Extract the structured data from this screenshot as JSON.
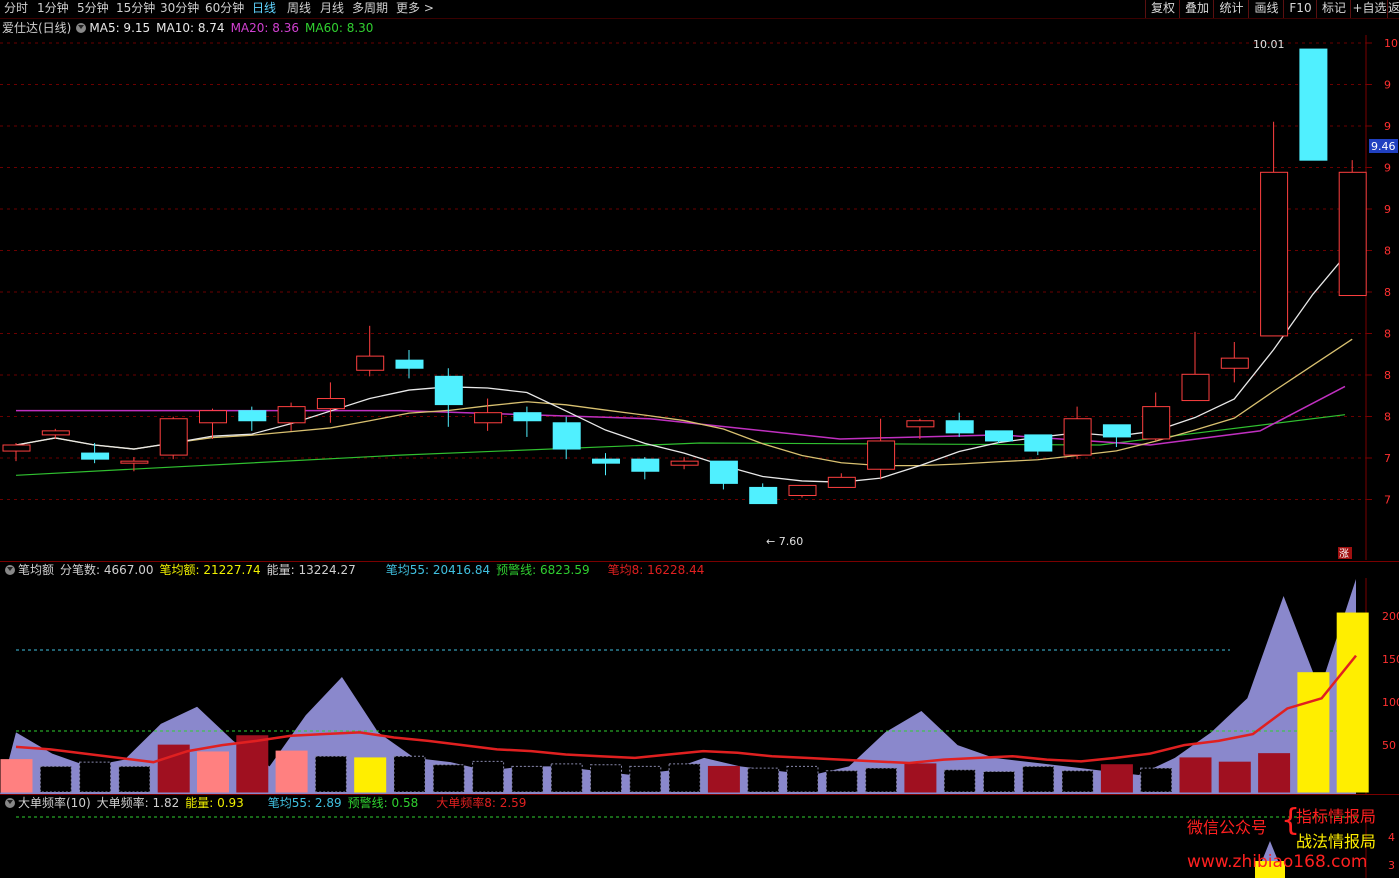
{
  "topbar": {
    "timeframes": [
      "分时",
      "1分钟",
      "5分钟",
      "15分钟",
      "30分钟",
      "60分钟",
      "日线",
      "周线",
      "月线",
      "多周期",
      "更多 >"
    ],
    "active_index": 6,
    "tools": [
      "复权",
      "叠加",
      "统计",
      "画线",
      "F10",
      "标记",
      "+自选",
      "返"
    ]
  },
  "main_legend": {
    "title": "爱仕达(日线)",
    "items": [
      {
        "label": "MA5: 9.15",
        "color": "#e8e8e8"
      },
      {
        "label": "MA10: 8.74",
        "color": "#e8e8e8"
      },
      {
        "label": "MA20: 8.36",
        "color": "#d040d0"
      },
      {
        "label": "MA60: 8.30",
        "color": "#30d030"
      }
    ]
  },
  "price_axis": {
    "labels": [
      "10",
      "9",
      "9",
      "9",
      "9",
      "8",
      "8",
      "8",
      "8",
      "8",
      "7",
      "7"
    ],
    "current_price": "9.46",
    "high_label": "10.01",
    "low_label": "7.60",
    "zhang": "涨"
  },
  "panel1_legend": {
    "items": [
      {
        "label": "笔均额",
        "color": "#d0d0d0"
      },
      {
        "label": "分笔数: 4667.00",
        "color": "#d0d0d0"
      },
      {
        "label": "笔均额: 21227.74",
        "color": "#f0f000"
      },
      {
        "label": "能量: 13224.27",
        "color": "#d0d0d0"
      },
      {
        "label": "笔均55: 20416.84",
        "color": "#40c0e0"
      },
      {
        "label": "预警线: 6823.59",
        "color": "#30d030"
      },
      {
        "label": "笔均8: 16228.44",
        "color": "#e02020"
      }
    ],
    "axis": [
      "200",
      "150",
      "100",
      "50"
    ]
  },
  "panel2_legend": {
    "items": [
      {
        "label": "大单频率(10)",
        "color": "#d0d0d0"
      },
      {
        "label": "大单频率: 1.82",
        "color": "#d0d0d0"
      },
      {
        "label": "能量: 0.93",
        "color": "#f0f000"
      },
      {
        "label": "笔均55: 2.89",
        "color": "#40c0e0"
      },
      {
        "label": "预警线: 0.58",
        "color": "#30d030"
      },
      {
        "label": "大单频率8: 2.59",
        "color": "#e02020"
      }
    ],
    "axis": [
      "4",
      "3"
    ]
  },
  "watermark": {
    "line1": "微信公众号",
    "line2a": "指标情报局",
    "line2b": "战法情报局",
    "url": "www.zhibiao168.com"
  },
  "chart_data": {
    "type": "candlestick",
    "candles": [
      {
        "o": 8.02,
        "c": 8.05,
        "h": 8.06,
        "l": 7.97
      },
      {
        "o": 8.1,
        "c": 8.12,
        "h": 8.13,
        "l": 8.08
      },
      {
        "o": 8.01,
        "c": 7.98,
        "h": 8.06,
        "l": 7.96
      },
      {
        "o": 7.97,
        "c": 7.97,
        "h": 7.99,
        "l": 7.92
      },
      {
        "o": 8.0,
        "c": 8.18,
        "h": 8.19,
        "l": 7.98
      },
      {
        "o": 8.16,
        "c": 8.22,
        "h": 8.23,
        "l": 8.08
      },
      {
        "o": 8.22,
        "c": 8.17,
        "h": 8.24,
        "l": 8.12
      },
      {
        "o": 8.16,
        "c": 8.24,
        "h": 8.26,
        "l": 8.12
      },
      {
        "o": 8.23,
        "c": 8.28,
        "h": 8.36,
        "l": 8.16
      },
      {
        "o": 8.42,
        "c": 8.49,
        "h": 8.64,
        "l": 8.39
      },
      {
        "o": 8.47,
        "c": 8.43,
        "h": 8.52,
        "l": 8.38
      },
      {
        "o": 8.39,
        "c": 8.25,
        "h": 8.43,
        "l": 8.14
      },
      {
        "o": 8.16,
        "c": 8.21,
        "h": 8.28,
        "l": 8.12
      },
      {
        "o": 8.21,
        "c": 8.17,
        "h": 8.24,
        "l": 8.09
      },
      {
        "o": 8.16,
        "c": 8.03,
        "h": 8.19,
        "l": 7.98
      },
      {
        "o": 7.98,
        "c": 7.96,
        "h": 8.01,
        "l": 7.9
      },
      {
        "o": 7.98,
        "c": 7.92,
        "h": 7.99,
        "l": 7.88
      },
      {
        "o": 7.95,
        "c": 7.97,
        "h": 7.99,
        "l": 7.93
      },
      {
        "o": 7.97,
        "c": 7.86,
        "h": 7.97,
        "l": 7.83
      },
      {
        "o": 7.84,
        "c": 7.76,
        "h": 7.86,
        "l": 7.76
      },
      {
        "o": 7.8,
        "c": 7.85,
        "h": 7.85,
        "l": 7.79
      },
      {
        "o": 7.84,
        "c": 7.89,
        "h": 7.91,
        "l": 7.84
      },
      {
        "o": 7.93,
        "c": 8.07,
        "h": 8.18,
        "l": 7.88
      },
      {
        "o": 8.14,
        "c": 8.17,
        "h": 8.18,
        "l": 8.08
      },
      {
        "o": 8.17,
        "c": 8.11,
        "h": 8.21,
        "l": 8.09
      },
      {
        "o": 8.12,
        "c": 8.07,
        "h": 8.12,
        "l": 8.06
      },
      {
        "o": 8.1,
        "c": 8.02,
        "h": 8.1,
        "l": 8.0
      },
      {
        "o": 8.0,
        "c": 8.18,
        "h": 8.24,
        "l": 7.98
      },
      {
        "o": 8.15,
        "c": 8.09,
        "h": 8.15,
        "l": 8.04
      },
      {
        "o": 8.08,
        "c": 8.24,
        "h": 8.31,
        "l": 8.07
      },
      {
        "o": 8.27,
        "c": 8.4,
        "h": 8.61,
        "l": 8.27
      },
      {
        "o": 8.43,
        "c": 8.48,
        "h": 8.56,
        "l": 8.36
      },
      {
        "o": 8.59,
        "c": 9.4,
        "h": 9.65,
        "l": 8.59
      },
      {
        "o": 10.01,
        "c": 9.46,
        "h": 10.01,
        "l": 9.46
      },
      {
        "o": 8.79,
        "c": 9.4,
        "h": 9.46,
        "l": 8.79
      }
    ],
    "ylim": [
      7.55,
      10.05
    ],
    "panel1": {
      "bars": [
        38,
        30,
        35,
        30,
        55,
        47,
        66,
        48,
        42,
        40,
        42,
        32,
        36,
        30,
        33,
        32,
        30,
        33,
        30,
        28,
        30,
        25,
        28,
        33,
        26,
        24,
        30,
        25,
        32,
        28,
        40,
        35,
        45,
        140,
        210
      ],
      "bar_colors": [
        "#ff8080",
        "#000",
        "#000",
        "#000",
        "#a01020",
        "#ff8080",
        "#a01020",
        "#ff8080",
        "#000",
        "#ffee00",
        "#000",
        "#000",
        "#000",
        "#000",
        "#000",
        "#000",
        "#000",
        "#000",
        "#a01020",
        "#000",
        "#000",
        "#000",
        "#000",
        "#a01020",
        "#000",
        "#000",
        "#000",
        "#000",
        "#a01020",
        "#000",
        "#a01020",
        "#a01020",
        "#a01020",
        "#ffee00",
        "#ffee00"
      ],
      "area": [
        70,
        45,
        30,
        38,
        80,
        100,
        60,
        30,
        90,
        135,
        70,
        40,
        35,
        25,
        30,
        30,
        25,
        20,
        25,
        40,
        30,
        25,
        20,
        30,
        70,
        95,
        55,
        40,
        35,
        30,
        25,
        20,
        40,
        70,
        110,
        230,
        120,
        250
      ],
      "red": [
        53,
        50,
        45,
        40,
        35,
        48,
        55,
        60,
        66,
        68,
        70,
        64,
        60,
        55,
        50,
        48,
        44,
        42,
        40,
        44,
        48,
        46,
        42,
        40,
        38,
        36,
        34,
        38,
        40,
        42,
        38,
        36,
        40,
        45,
        55,
        60,
        68,
        98,
        110,
        160
      ],
      "ylim": [
        0,
        230
      ]
    }
  }
}
